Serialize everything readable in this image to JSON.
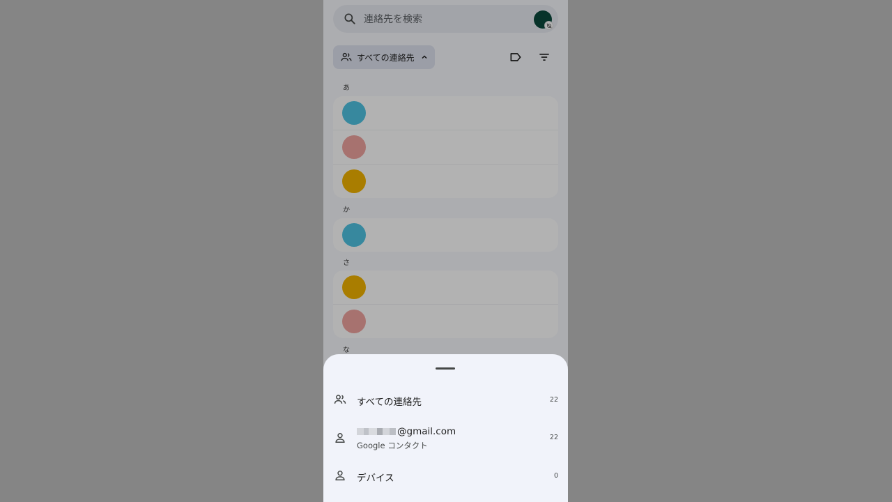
{
  "search": {
    "placeholder": "連絡先を検索"
  },
  "filter_chip": {
    "label": "すべての連絡先"
  },
  "sections": [
    {
      "letter": "あ",
      "contacts": [
        {
          "color": "#4fc3e2"
        },
        {
          "color": "#f0a4a0"
        },
        {
          "color": "#f2b400"
        }
      ]
    },
    {
      "letter": "か",
      "contacts": [
        {
          "color": "#4fc3e2"
        }
      ]
    },
    {
      "letter": "さ",
      "contacts": [
        {
          "color": "#f2b400"
        },
        {
          "color": "#f0a4a0"
        }
      ]
    },
    {
      "letter": "な",
      "contacts": []
    }
  ],
  "sheet": {
    "items": [
      {
        "label": "すべての連絡先",
        "count": "22",
        "icon": "people-icon"
      },
      {
        "label": "@gmail.com",
        "sublabel": "Google コンタクト",
        "count": "22",
        "icon": "person-icon"
      },
      {
        "label": "デバイス",
        "count": "0",
        "icon": "person-icon"
      }
    ]
  },
  "colors": {
    "avatar_me": "#0b4a3d",
    "sheet_bg": "#f1f3fa",
    "chip_bg": "#dfe3f0"
  }
}
